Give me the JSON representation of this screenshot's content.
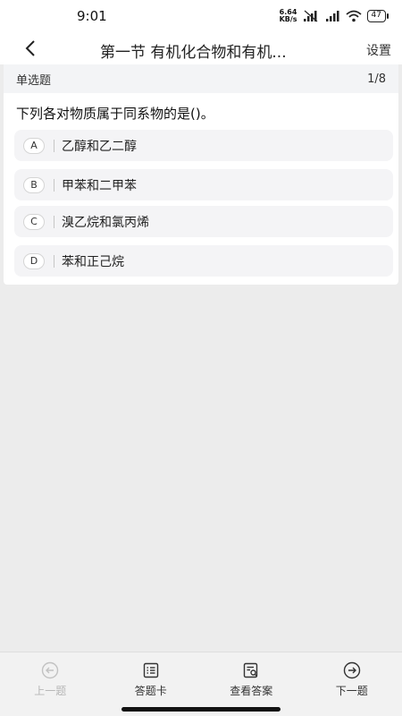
{
  "status_bar": {
    "time": "9:01",
    "net_speed_value": "6.64",
    "net_speed_unit": "KB/s",
    "battery": "47"
  },
  "nav": {
    "title": "第一节 有机化合物和有机...",
    "settings_label": "设置"
  },
  "question": {
    "type_label": "单选题",
    "counter": "1/8",
    "stem": "下列各对物质属于同系物的是()。",
    "options": [
      {
        "letter": "A",
        "text": "乙醇和乙二醇"
      },
      {
        "letter": "B",
        "text": "甲苯和二甲苯"
      },
      {
        "letter": "C",
        "text": "溴乙烷和氯丙烯"
      },
      {
        "letter": "D",
        "text": "苯和正己烷"
      }
    ]
  },
  "bottom_bar": {
    "prev_label": "上一题",
    "card_label": "答题卡",
    "answer_label": "查看答案",
    "next_label": "下一题"
  },
  "colors": {
    "background": "#ececec",
    "option_bg": "#f4f4f6",
    "disabled_text": "#b7b7b7"
  }
}
